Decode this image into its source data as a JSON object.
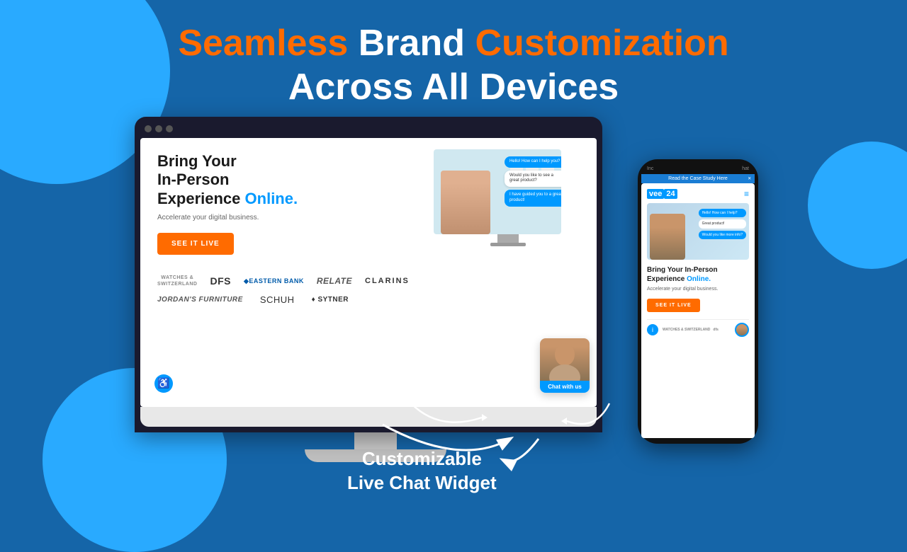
{
  "page": {
    "background_color": "#1565a8",
    "title": "Seamless Brand Customization Across All Devices"
  },
  "header": {
    "line1_part1": "Seamless",
    "line1_part2": "Brand",
    "line1_part3": "Customization",
    "line2": "Across All Devices"
  },
  "desktop_site": {
    "headline_part1": "Bring Your",
    "headline_part2": "In-Person",
    "headline_part3": "Experience",
    "headline_highlight": "Online.",
    "subtext": "Accelerate your digital business.",
    "cta_button": "SEE IT LIVE",
    "chat_widget_label": "Chat with us",
    "brands": [
      "WATCHES & SWITZERLAND",
      "dfs",
      "Eastern Bank",
      "relate",
      "CLARINS",
      "Jordan's Furniture",
      "schuh",
      "♦ Sytner"
    ]
  },
  "phone_site": {
    "case_study_bar": "Read the Case Study Here",
    "logo_text": "vee",
    "logo_number": "24",
    "headline_part1": "Bring Your In-Person",
    "headline_part2": "Experience",
    "headline_highlight": "Online.",
    "subtext": "Accelerate your digital business.",
    "cta_button": "SEE IT LIVE"
  },
  "chat_bubbles": [
    "Hello! How can I help you today?",
    "Would you like to see a great product?",
    "I have guided you to a great product, would you like to know a bit more?"
  ],
  "label": {
    "line1": "Customizable",
    "line2": "Live Chat Widget"
  },
  "icons": {
    "accessibility": "♿",
    "hamburger": "≡",
    "info": "i",
    "close": "×"
  }
}
